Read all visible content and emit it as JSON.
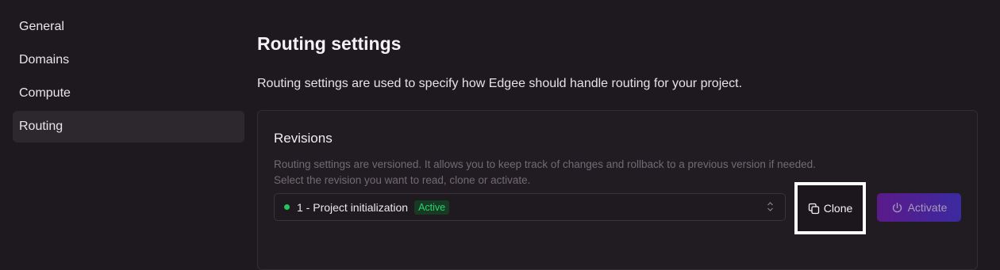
{
  "sidebar": {
    "items": [
      {
        "label": "General"
      },
      {
        "label": "Domains"
      },
      {
        "label": "Compute"
      },
      {
        "label": "Routing"
      }
    ]
  },
  "main": {
    "title": "Routing settings",
    "description": "Routing settings are used to specify how Edgee should handle routing for your project."
  },
  "revisions": {
    "title": "Revisions",
    "description_line1": "Routing settings are versioned. It allows you to keep track of changes and rollback to a previous version if needed.",
    "description_line2": "Select the revision you want to read, clone or activate.",
    "selected_revision": "1 - Project initialization",
    "selected_badge": "Active",
    "clone_label": "Clone",
    "activate_label": "Activate"
  },
  "icons": {
    "status_dot": "status-dot-icon",
    "select_chevrons": "chevron-up-down-icon",
    "clone": "copy-icon",
    "activate": "power-icon"
  },
  "colors": {
    "background": "#1e191f",
    "active_status": "#22c55e",
    "activate_gradient_start": "#5b1a8a",
    "activate_gradient_end": "#3b2aa0"
  }
}
